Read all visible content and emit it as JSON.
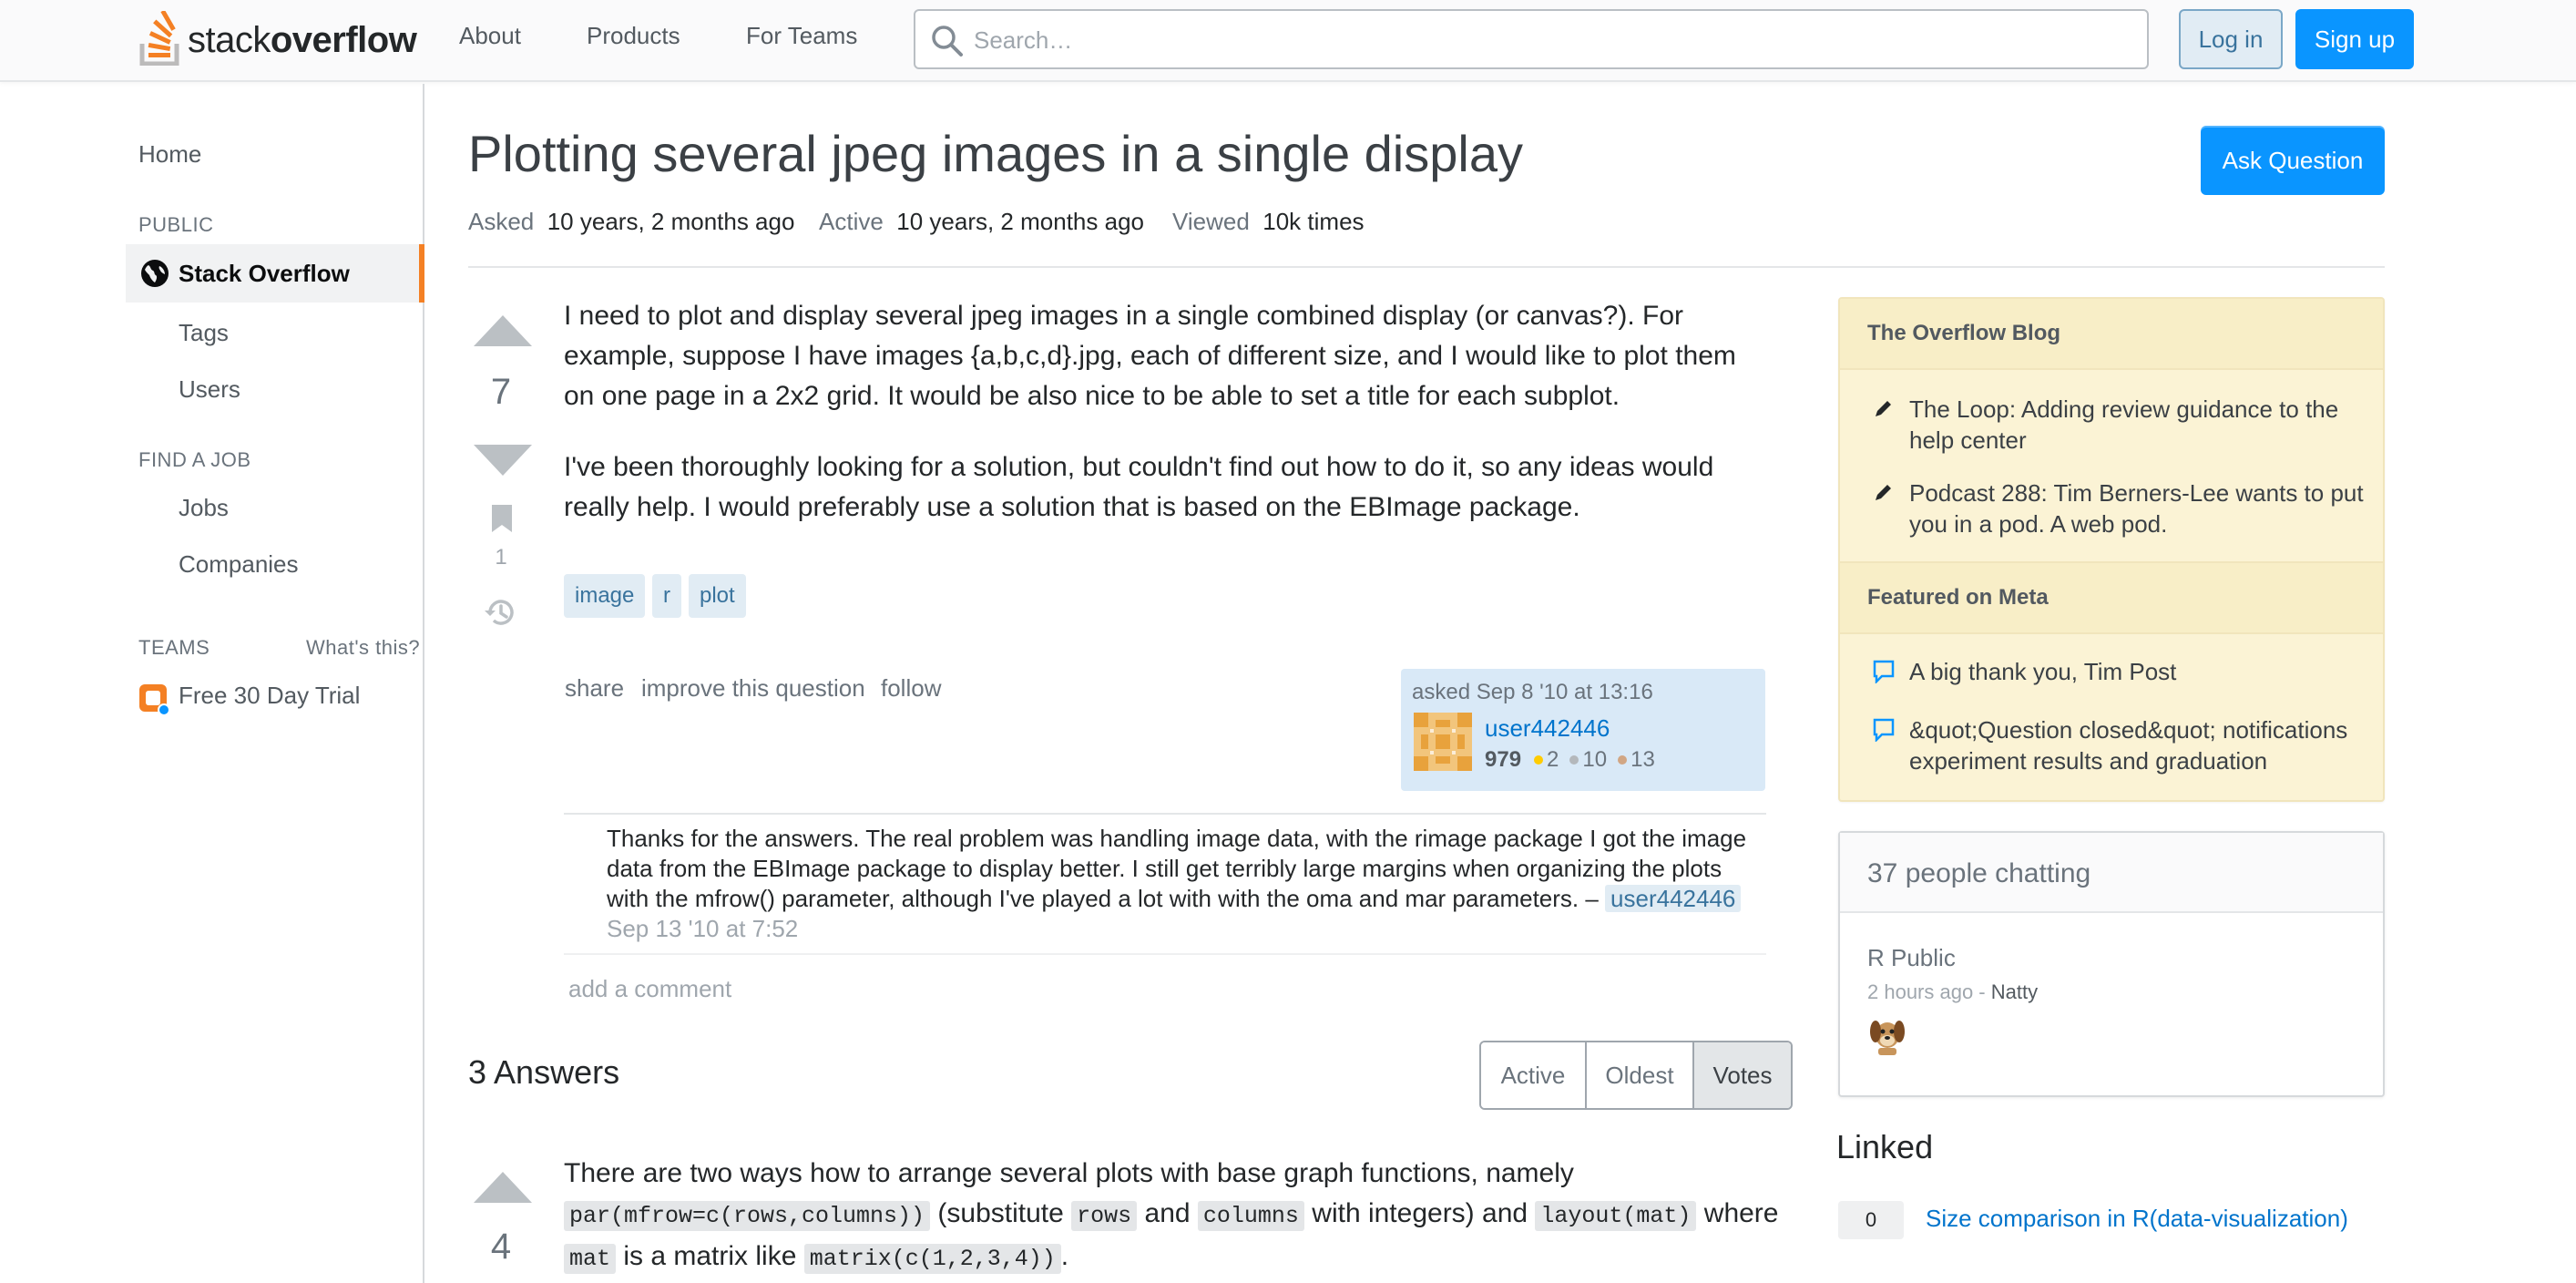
{
  "header": {
    "brand_plain": "stack",
    "brand_bold": "overflow",
    "nav": [
      "About",
      "Products",
      "For Teams"
    ],
    "search_placeholder": "Search…",
    "login": "Log in",
    "signup": "Sign up"
  },
  "sidebar": {
    "home": "Home",
    "public_label": "PUBLIC",
    "stack_overflow": "Stack Overflow",
    "tags": "Tags",
    "users": "Users",
    "find_job_label": "FIND A JOB",
    "jobs": "Jobs",
    "companies": "Companies",
    "teams_label": "TEAMS",
    "whats_this": "What's this?",
    "trial": "Free 30 Day Trial"
  },
  "question": {
    "title": "Plotting several jpeg images in a single display",
    "ask_button": "Ask Question",
    "meta": {
      "asked_label": "Asked",
      "asked_value": "10 years, 2 months ago",
      "active_label": "Active",
      "active_value": "10 years, 2 months ago",
      "viewed_label": "Viewed",
      "viewed_value": "10k times"
    },
    "votes": "7",
    "bookmarks": "1",
    "body": [
      "I need to plot and display several jpeg images in a single combined display (or canvas?). For example, suppose I have images {a,b,c,d}.jpg, each of different size, and I would like to plot them on one page in a 2x2 grid. It would be also nice to be able to set a title for each subplot.",
      "I've been thoroughly looking for a solution, but couldn't find out how to do it, so any ideas would really help. I would preferably use a solution that is based on the EBImage package."
    ],
    "tags": [
      "image",
      "r",
      "plot"
    ],
    "actions": [
      "share",
      "improve this question",
      "follow"
    ],
    "owner": {
      "asked": "asked Sep 8 '10 at 13:16",
      "name": "user442446",
      "rep": "979",
      "gold": "2",
      "silver": "10",
      "bronze": "13"
    },
    "comment": {
      "text": "Thanks for the answers. The real problem was handling image data, with the rimage package I got the image data from the EBImage package to display better. I still get terribly large margins when organizing the plots with the mfrow() parameter, although I've played a lot with with the oma and mar parameters. – ",
      "user": "user442446",
      "date": "Sep 13 '10 at 7:52"
    },
    "add_comment": "add a comment"
  },
  "answers": {
    "heading": "3 Answers",
    "sort_options": [
      "Active",
      "Oldest",
      "Votes"
    ],
    "sort_selected": "Votes",
    "first": {
      "votes": "4",
      "t1": "There are two ways how to arrange several plots with base graph functions, namely ",
      "c1": "par(mfrow=c(rows,columns))",
      "t2": " (substitute ",
      "c2": "rows",
      "t3": " and ",
      "c3": "columns",
      "t4": " with integers) and ",
      "c4": "layout(mat)",
      "t5": " where ",
      "c5": "mat",
      "t6": " is a matrix like ",
      "c6": "matrix(c(1,2,3,4))",
      "t7": "."
    }
  },
  "right": {
    "blog_heading": "The Overflow Blog",
    "blog_items": [
      "The Loop: Adding review guidance to the help center",
      "Podcast 288: Tim Berners-Lee wants to put you in a pod. A web pod."
    ],
    "meta_heading": "Featured on Meta",
    "meta_items": [
      "A big thank you, Tim Post",
      "&quot;Question closed&quot; notifications experiment results and graduation"
    ],
    "chat_heading": "37 people chatting",
    "chat_room": "R Public",
    "chat_ago": "2 hours ago - ",
    "chat_user": "Natty",
    "linked_heading": "Linked",
    "linked_count": "0",
    "linked_title": "Size comparison in R(data-visualization)"
  },
  "colors": {
    "accent": "#0a95ff",
    "brand_orange": "#f48024",
    "link": "#0074cc",
    "blog_bg": "#fbf3d5"
  }
}
